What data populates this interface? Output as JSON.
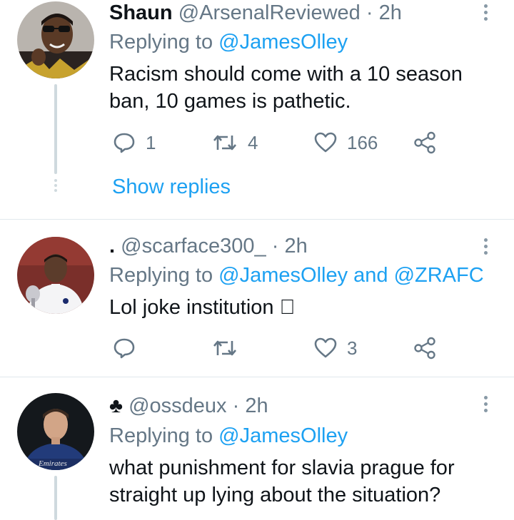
{
  "tweets": [
    {
      "name": "Shaun",
      "handle": "@ArsenalReviewed",
      "time": "· 2h",
      "replying_prefix": "Replying to",
      "replying_to": "@JamesOlley",
      "text_lines": [
        "Racism should come with a 10 season",
        "ban, 10 games is pathetic."
      ],
      "reply_count": "1",
      "retweet_count": "4",
      "like_count": "166",
      "show_replies": "Show replies"
    },
    {
      "name": ".",
      "handle": "@scarface300_",
      "time": "· 2h",
      "replying_prefix": "Replying to",
      "replying_to": "@JamesOlley and @ZRAFC",
      "text_lines": [
        "Lol joke institution \u0000"
      ],
      "reply_count": "",
      "retweet_count": "",
      "like_count": "3"
    },
    {
      "name": "♣",
      "handle": "@ossdeux",
      "time": "· 2h",
      "replying_prefix": "Replying to",
      "replying_to": "@JamesOlley",
      "text_lines": [
        "what punishment for slavia prague for",
        "straight up lying about the situation?"
      ]
    }
  ],
  "icons": {
    "reply": "reply-icon",
    "retweet": "retweet-icon",
    "like": "heart-icon",
    "share": "share-icon",
    "more": "more-vertical-icon"
  },
  "colors": {
    "link": "#1da1f2",
    "muted": "#657786",
    "thread": "#cfd9de"
  }
}
